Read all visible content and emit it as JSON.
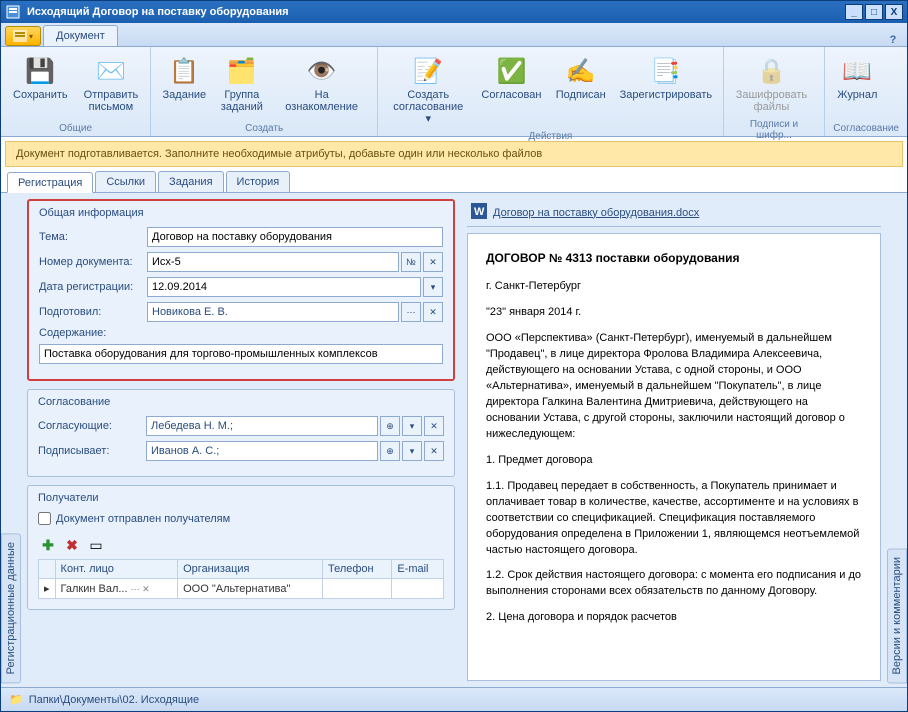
{
  "window": {
    "title": "Исходящий Договор на поставку оборудования"
  },
  "ribbon": {
    "tab_document": "Документ",
    "groups": {
      "general": "Общие",
      "create": "Создать",
      "actions": "Действия",
      "sign": "Подписи и шифр...",
      "approve": "Согласование"
    },
    "buttons": {
      "save": "Сохранить",
      "send_mail": "Отправить\nписьмом",
      "task": "Задание",
      "task_group": "Группа\nзаданий",
      "review": "На ознакомление",
      "create_approval": "Создать\nсогласование ▾",
      "approved": "Согласован",
      "signed": "Подписан",
      "register": "Зарегистрировать",
      "encrypt": "Зашифровать\nфайлы",
      "journal": "Журнал"
    }
  },
  "infobar": "Документ подготавливается. Заполните необходимые атрибуты, добавьте один или несколько файлов",
  "tabs": {
    "registration": "Регистрация",
    "links": "Ссылки",
    "tasks": "Задания",
    "history": "История"
  },
  "side_tabs": {
    "left": "Регистрационные данные",
    "right": "Версии и комментарии"
  },
  "general_info": {
    "title": "Общая информация",
    "subject_label": "Тема:",
    "subject": "Договор на поставку оборудования",
    "number_label": "Номер документа:",
    "number": "Исх-5",
    "number_btn": "№",
    "date_label": "Дата регистрации:",
    "date": "12.09.2014",
    "author_label": "Подготовил:",
    "author": "Новикова Е. В.",
    "content_label": "Содержание:",
    "content": "Поставка оборудования для торгово-промышленных комплексов"
  },
  "approval": {
    "title": "Согласование",
    "approvers_label": "Согласующие:",
    "approvers": "Лебедева Н. М.;",
    "signer_label": "Подписывает:",
    "signer": "Иванов А. С.;"
  },
  "recipients": {
    "title": "Получатели",
    "sent_checkbox": "Документ отправлен получателям",
    "columns": {
      "contact": "Конт. лицо",
      "org": "Организация",
      "phone": "Телефон",
      "email": "E-mail"
    },
    "rows": [
      {
        "contact": "Галкин Вал...",
        "org": "ООО \"Альтернатива\"",
        "phone": "",
        "email": ""
      }
    ]
  },
  "file": {
    "name": "Договор на поставку оборудования.docx"
  },
  "preview": {
    "heading": "ДОГОВОР № 4313 поставки оборудования",
    "city": "г. Санкт-Петербург",
    "date": "\"23\"  января 2014 г.",
    "p1": "ООО «Перспектива» (Санкт-Петербург), именуемый в дальнейшем \"Продавец\", в лице директора Фролова Владимира Алексеевича, действующего на основании Устава, с одной стороны, и ООО «Альтернатива», именуемый в дальнейшем \"Покупатель\", в лице директора  Галкина Валентина Дмитриевича, действующего на основании Устава, с другой стороны, заключили настоящий договор о нижеследующем:",
    "h1": "1. Предмет договора",
    "p2": "1.1. Продавец передает в собственность, а Покупатель принимает и оплачивает товар в количестве, качестве, ассортименте и на условиях в соответствии со спецификацией. Спецификация поставляемого оборудования определена в Приложении 1, являющемся неотъемлемой частью настоящего договора.",
    "p3": "1.2. Срок действия настоящего договора: с момента его подписания и до выполнения сторонами всех обязательств по данному Договору.",
    "h2": "2. Цена договора и порядок расчетов"
  },
  "statusbar": {
    "path": "Папки\\Документы\\02. Исходящие"
  }
}
